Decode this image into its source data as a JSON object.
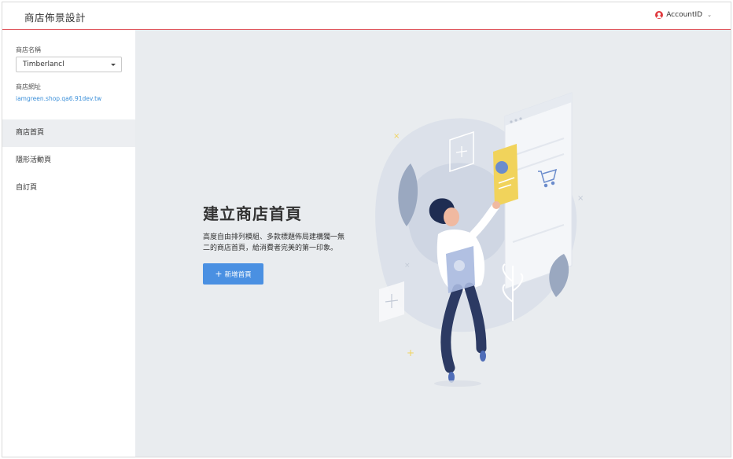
{
  "header": {
    "title": "商店佈景設計",
    "account_label": "AccountID",
    "account_icon": "user-avatar-icon",
    "chevron_icon": "chevron-down-icon"
  },
  "sidebar": {
    "shop_name_label": "商店名稱",
    "shop_select_value": "Timberlancl",
    "shop_url_label": "商店網址",
    "shop_url": "iamgreen.shop.qa6.91dev.tw",
    "items": [
      {
        "label": "商店首頁",
        "active": true
      },
      {
        "label": "隱形活動頁",
        "active": false
      },
      {
        "label": "自訂頁",
        "active": false
      }
    ]
  },
  "main": {
    "title": "建立商店首頁",
    "description": "高度自由排列模組、多款標題佈局建構獨一無二的商店首頁，給消費者完美的第一印象。",
    "add_button_label": "新增首頁",
    "add_button_icon": "plus-icon"
  },
  "colors": {
    "accent": "#4a90e2",
    "header_border": "#e0585f",
    "avatar": "#e0393e",
    "link": "#3b8fd9",
    "main_bg": "#e9ecef",
    "nav_active_bg": "#eceef1"
  }
}
